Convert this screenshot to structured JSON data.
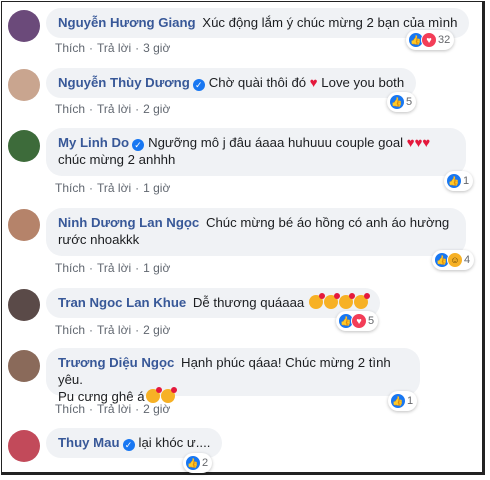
{
  "comments": [
    {
      "name": "Nguyễn Hương Giang",
      "verified": false,
      "text": "Xúc động lắm ý chúc mừng 2 bạn của mình",
      "like": "Thích",
      "reply": "Trả lời",
      "time": "3 giờ",
      "reaction_count": "32",
      "reactions": [
        "like",
        "love"
      ],
      "avatar_color": "#6b4a7a"
    },
    {
      "name": "Nguyễn Thùy Dương",
      "verified": true,
      "text": "Chờ quài thôi đó",
      "text2": "Love you both",
      "like": "Thích",
      "reply": "Trả lời",
      "time": "2 giờ",
      "reaction_count": "5",
      "reactions": [
        "like"
      ],
      "avatar_color": "#c9a58f"
    },
    {
      "name": "My Linh Do",
      "verified": true,
      "text": "Ngưỡng mô j đâu áaaa huhuuu couple goal",
      "text_line2": "chúc mừng 2 anhhh",
      "like": "Thích",
      "reply": "Trả lời",
      "time": "1 giờ",
      "reaction_count": "1",
      "reactions": [
        "like"
      ],
      "avatar_color": "#3d6b3a"
    },
    {
      "name": "Ninh Dương Lan Ngọc",
      "verified": false,
      "text": "Chúc mừng bé áo hồng có anh áo hường",
      "text_line2": "rước nhoakkk",
      "like": "Thích",
      "reply": "Trả lời",
      "time": "1 giờ",
      "reaction_count": "4",
      "reactions": [
        "like",
        "haha"
      ],
      "avatar_color": "#b5836a"
    },
    {
      "name": "Tran Ngoc Lan Khue",
      "verified": false,
      "text": "Dễ thương quáaaa",
      "like": "Thích",
      "reply": "Trả lời",
      "time": "2 giờ",
      "reaction_count": "5",
      "reactions": [
        "like",
        "love"
      ],
      "avatar_color": "#5a4a48"
    },
    {
      "name": "Trương Diệu Ngọc",
      "verified": false,
      "text": "Hạnh phúc qáaa! Chúc mừng 2 tình yêu.",
      "text_line2": "Pu cưng ghê á",
      "like": "Thích",
      "reply": "Trả lời",
      "time": "2 giờ",
      "reaction_count": "1",
      "reactions": [
        "like"
      ],
      "avatar_color": "#8a6a5a"
    },
    {
      "name": "Thuy Mau",
      "verified": true,
      "text": "lại khóc ư....",
      "like": "Thích",
      "reply": "Trả lời",
      "time": "2 giờ",
      "reaction_count": "2",
      "reactions": [
        "like"
      ],
      "avatar_color": "#c24a5a"
    }
  ]
}
